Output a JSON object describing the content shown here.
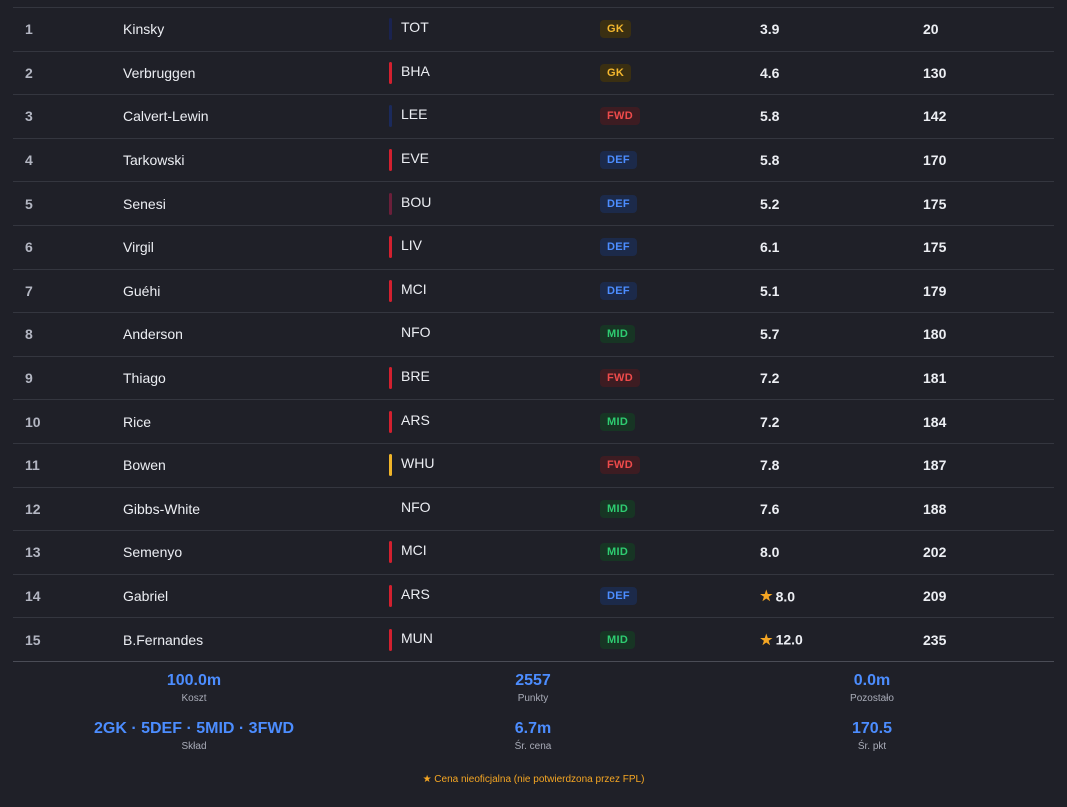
{
  "players": [
    {
      "rank": "1",
      "name": "Kinsky",
      "team": "TOT",
      "team_color": "#1a2350",
      "pos": "GK",
      "price": "3.9",
      "star": false,
      "pts": "20"
    },
    {
      "rank": "2",
      "name": "Verbruggen",
      "team": "BHA",
      "team_color": "#d3202f",
      "pos": "GK",
      "price": "4.6",
      "star": false,
      "pts": "130"
    },
    {
      "rank": "3",
      "name": "Calvert-Lewin",
      "team": "LEE",
      "team_color": "#1b2a5c",
      "pos": "FWD",
      "price": "5.8",
      "star": false,
      "pts": "142"
    },
    {
      "rank": "4",
      "name": "Tarkowski",
      "team": "EVE",
      "team_color": "#d3202f",
      "pos": "DEF",
      "price": "5.8",
      "star": false,
      "pts": "170"
    },
    {
      "rank": "5",
      "name": "Senesi",
      "team": "BOU",
      "team_color": "#6b1f3a",
      "pos": "DEF",
      "price": "5.2",
      "star": false,
      "pts": "175"
    },
    {
      "rank": "6",
      "name": "Virgil",
      "team": "LIV",
      "team_color": "#d3202f",
      "pos": "DEF",
      "price": "6.1",
      "star": false,
      "pts": "175"
    },
    {
      "rank": "7",
      "name": "Guéhi",
      "team": "MCI",
      "team_color": "#d3202f",
      "pos": "DEF",
      "price": "5.1",
      "star": false,
      "pts": "179"
    },
    {
      "rank": "8",
      "name": "Anderson",
      "team": "NFO",
      "team_color": "transparent",
      "pos": "MID",
      "price": "5.7",
      "star": false,
      "pts": "180"
    },
    {
      "rank": "9",
      "name": "Thiago",
      "team": "BRE",
      "team_color": "#d3202f",
      "pos": "FWD",
      "price": "7.2",
      "star": false,
      "pts": "181"
    },
    {
      "rank": "10",
      "name": "Rice",
      "team": "ARS",
      "team_color": "#d3202f",
      "pos": "MID",
      "price": "7.2",
      "star": false,
      "pts": "184"
    },
    {
      "rank": "11",
      "name": "Bowen",
      "team": "WHU",
      "team_color": "#f0b429",
      "pos": "FWD",
      "price": "7.8",
      "star": false,
      "pts": "187"
    },
    {
      "rank": "12",
      "name": "Gibbs-White",
      "team": "NFO",
      "team_color": "transparent",
      "pos": "MID",
      "price": "7.6",
      "star": false,
      "pts": "188"
    },
    {
      "rank": "13",
      "name": "Semenyo",
      "team": "MCI",
      "team_color": "#d3202f",
      "pos": "MID",
      "price": "8.0",
      "star": false,
      "pts": "202"
    },
    {
      "rank": "14",
      "name": "Gabriel",
      "team": "ARS",
      "team_color": "#d3202f",
      "pos": "DEF",
      "price": "8.0",
      "star": true,
      "pts": "209"
    },
    {
      "rank": "15",
      "name": "B.Fernandes",
      "team": "MUN",
      "team_color": "#d3202f",
      "pos": "MID",
      "price": "12.0",
      "star": true,
      "pts": "235"
    }
  ],
  "pos_colors": {
    "GK": {
      "fg": "#f5b82e",
      "bg": "#3a2f12"
    },
    "DEF": {
      "fg": "#4c8dff",
      "bg": "#1c2a4a"
    },
    "MID": {
      "fg": "#2ecc71",
      "bg": "#173524"
    },
    "FWD": {
      "fg": "#ef4b4b",
      "bg": "#3d1c22"
    }
  },
  "star_glyph": "★",
  "summary": {
    "cost": {
      "value": "100.0m",
      "label": "Koszt"
    },
    "points": {
      "value": "2557",
      "label": "Punkty"
    },
    "remaining": {
      "value": "0.0m",
      "label": "Pozostało"
    },
    "squad": {
      "value": "2GK · 5DEF · 5MID · 3FWD",
      "label": "Skład"
    },
    "avg_price": {
      "value": "6.7m",
      "label": "Śr. cena"
    },
    "avg_points": {
      "value": "170.5",
      "label": "Śr. pkt"
    }
  },
  "footnote": "★ Cena nieoficjalna (nie potwierdzona przez FPL)"
}
